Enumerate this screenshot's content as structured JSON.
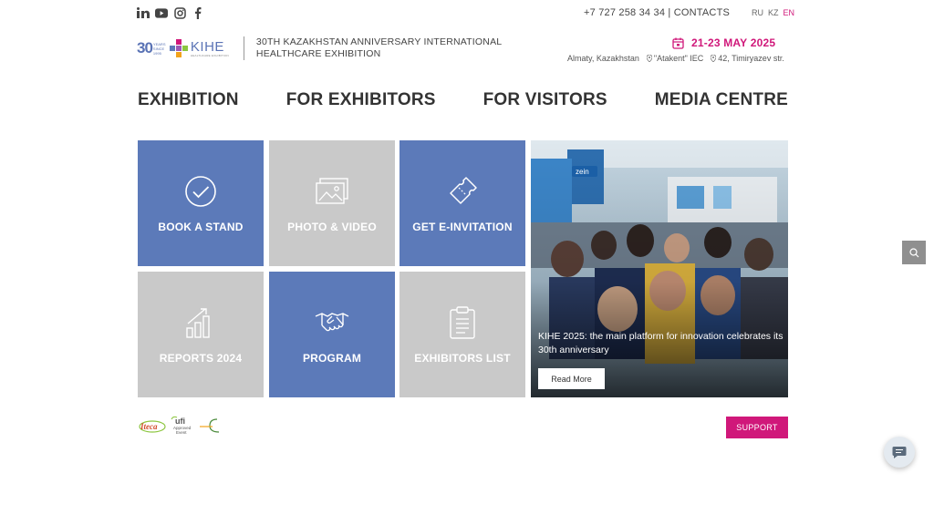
{
  "topbar": {
    "social_icons": [
      "linkedin-icon",
      "youtube-icon",
      "instagram-icon",
      "facebook-icon"
    ],
    "phone": "+7 727 258 34 34",
    "separator": "|",
    "contacts": "CONTACTS",
    "languages": [
      {
        "code": "RU",
        "active": false
      },
      {
        "code": "KZ",
        "active": false
      },
      {
        "code": "EN",
        "active": true
      }
    ]
  },
  "header": {
    "logo_number": "30",
    "logo_years": "YEARS SINCE 1995",
    "logo_name": "KIHE",
    "logo_sub": "HEALTHCARE EXHIBITION",
    "exhibition_title": "30TH KAZAKHSTAN ANNIVERSARY INTERNATIONAL HEALTHCARE EXHIBITION",
    "date": "21-23 MAY 2025",
    "city": "Almaty, Kazakhstan",
    "venue": "\"Atakent\" IEC",
    "address": "42, Timiryazev str."
  },
  "nav": {
    "items": [
      "EXHIBITION",
      "FOR EXHIBITORS",
      "FOR VISITORS",
      "MEDIA CENTRE"
    ]
  },
  "tiles": [
    {
      "label": "BOOK A STAND",
      "icon": "check-circle-icon"
    },
    {
      "label": "PHOTO & VIDEO",
      "icon": "photos-icon"
    },
    {
      "label": "GET E-INVITATION",
      "icon": "ticket-icon"
    },
    {
      "label": "REPORTS 2024",
      "icon": "growth-chart-icon"
    },
    {
      "label": "PROGRAM",
      "icon": "handshake-icon"
    },
    {
      "label": "EXHIBITORS LIST",
      "icon": "clipboard-icon"
    }
  ],
  "feature": {
    "caption": "KIHE 2025: the main platform for innovation celebrates its 30th anniversary",
    "button": "Read More",
    "booth_sign": "zein"
  },
  "footer": {
    "partners": [
      "Iteca",
      "ufi",
      "Approved",
      "Event"
    ],
    "support": "SUPPORT"
  },
  "colors": {
    "accent": "#d0187a",
    "tile_blue": "#5c7ab9",
    "tile_grey": "#c9c9c9"
  }
}
